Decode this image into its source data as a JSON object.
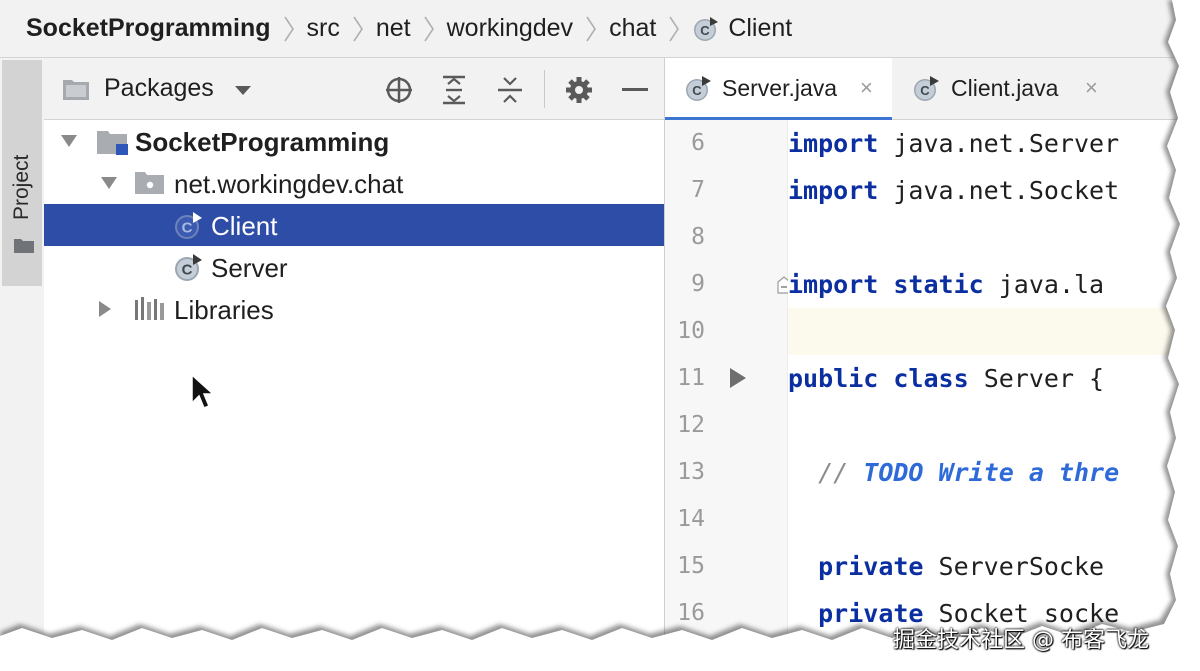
{
  "breadcrumb": {
    "items": [
      "SocketProgramming",
      "src",
      "net",
      "workingdev",
      "chat",
      "Client"
    ]
  },
  "stripe": {
    "label": "Project"
  },
  "panel": {
    "title": "Packages"
  },
  "tree": {
    "root": "SocketProgramming",
    "package": "net.workingdev.chat",
    "client": "Client",
    "server": "Server",
    "libraries": "Libraries"
  },
  "tabs": [
    {
      "label": "Server.java",
      "close": "×"
    },
    {
      "label": "Client.java",
      "close": "×"
    }
  ],
  "editor": {
    "line_numbers": [
      "6",
      "7",
      "8",
      "9",
      "10",
      "11",
      "12",
      "13",
      "14",
      "15",
      "16"
    ],
    "lines": {
      "l6": {
        "kw": "import",
        "rest": " java.net.Server"
      },
      "l7": {
        "kw": "import",
        "rest": " java.net.Socket"
      },
      "l9": {
        "kw1": "import",
        "kw2": "static",
        "rest": " java.la"
      },
      "l11": {
        "kw1": "public",
        "kw2": "class",
        "rest": " Server {"
      },
      "l13": {
        "prefix": "  // ",
        "todo": "TODO Write a thre"
      },
      "l15": {
        "kw": "private",
        "rest": " ServerSocke"
      },
      "l16": {
        "kw": "private",
        "rest": " Socket socke"
      }
    }
  },
  "watermark": "掘金技术社区 @ 布客飞龙",
  "colors": {
    "selection": "#2e4da6",
    "keyword": "#0b2fa0",
    "todo": "#2f6bd8",
    "tab_underline": "#3d75d3"
  }
}
